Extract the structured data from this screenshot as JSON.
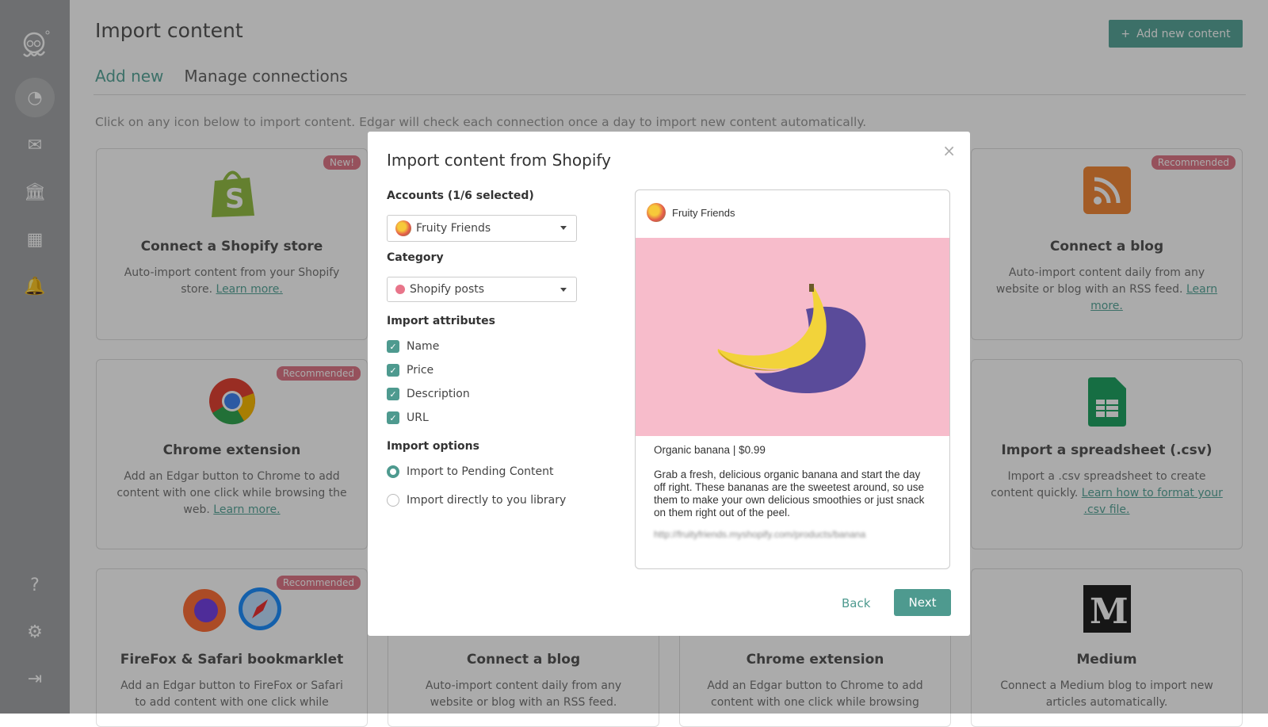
{
  "sidebar": {
    "icons": [
      "edgar-octopus-logo",
      "dashboard-icon",
      "mail-icon",
      "library-icon",
      "calendar-icon",
      "bell-icon",
      "help-icon",
      "gear-icon",
      "logout-icon"
    ]
  },
  "header": {
    "title": "Import content",
    "add_button": "Add new content"
  },
  "tabs": [
    {
      "label": "Add new",
      "active": true
    },
    {
      "label": "Manage connections",
      "active": false
    }
  ],
  "info_text": "Click on any icon below to import content. Edgar will check each connection once a day to import new content automatically.",
  "cards": [
    {
      "title": "Connect a Shopify store",
      "badge": "New!",
      "desc": "Auto-import content from your Shopify store.",
      "link": "Learn more.",
      "icon": "shopify-icon"
    },
    {
      "title": "Connect a blog",
      "badge": "Recommended",
      "desc": "Auto-import content daily from any website or blog with an RSS feed.",
      "link": "Learn more.",
      "icon": "rss-icon"
    },
    {
      "title": "Chrome extension",
      "badge": "Recommended",
      "desc": "Add an Edgar button to Chrome to add content with one click while browsing the web.",
      "link": "Learn more.",
      "icon": "chrome-icon"
    },
    {
      "title": "Import a spreadsheet (.csv)",
      "badge": "",
      "desc": "Import a .csv spreadsheet to create content quickly.",
      "link": "Learn how to format your .csv file.",
      "icon": "spreadsheet-icon"
    },
    {
      "title": "FireFox & Safari bookmarklet",
      "badge": "Recommended",
      "desc": "Add an Edgar button to FireFox or Safari to add content with one click while",
      "link": "",
      "icon": "firefox-safari-icon"
    },
    {
      "title": "Connect a blog",
      "badge": "",
      "desc": "Auto-import content daily from any website or blog with an RSS feed.",
      "link": "",
      "icon": "rss-icon"
    },
    {
      "title": "Chrome extension",
      "badge": "",
      "desc": "Add an Edgar button to Chrome to add content with one click while browsing",
      "link": "",
      "icon": "chrome-icon"
    },
    {
      "title": "Medium",
      "badge": "",
      "desc": "Connect a Medium blog to import new articles automatically.",
      "link": "",
      "icon": "medium-icon"
    }
  ],
  "dialog": {
    "title": "Import content from Shopify",
    "accounts_label": "Accounts (1/6 selected)",
    "account_value": "Fruity Friends",
    "category_label": "Category",
    "category_value": "Shopify posts",
    "category_color": "#e8758a",
    "attributes_label": "Import attributes",
    "attributes": [
      {
        "label": "Name",
        "checked": true
      },
      {
        "label": "Price",
        "checked": true
      },
      {
        "label": "Description",
        "checked": true
      },
      {
        "label": "URL",
        "checked": true
      }
    ],
    "options_label": "Import options",
    "options": [
      {
        "label": "Import to Pending Content",
        "selected": true
      },
      {
        "label": "Import directly to you library",
        "selected": false
      }
    ],
    "preview": {
      "account": "Fruity Friends",
      "headline": "Organic banana | $0.99",
      "description": "Grab a fresh, delicious organic banana and start the day off right. These bananas are the sweetest around, so use them to make your own delicious smoothies or just snack on them right out of the peel.",
      "url": "http://fruityfriends.myshopify.com/products/banana"
    },
    "back_label": "Back",
    "next_label": "Next",
    "close_label": "×"
  },
  "colors": {
    "accent": "#4e9a8f",
    "badge": "#e07a8a",
    "preview_bg": "#f7bccb"
  }
}
